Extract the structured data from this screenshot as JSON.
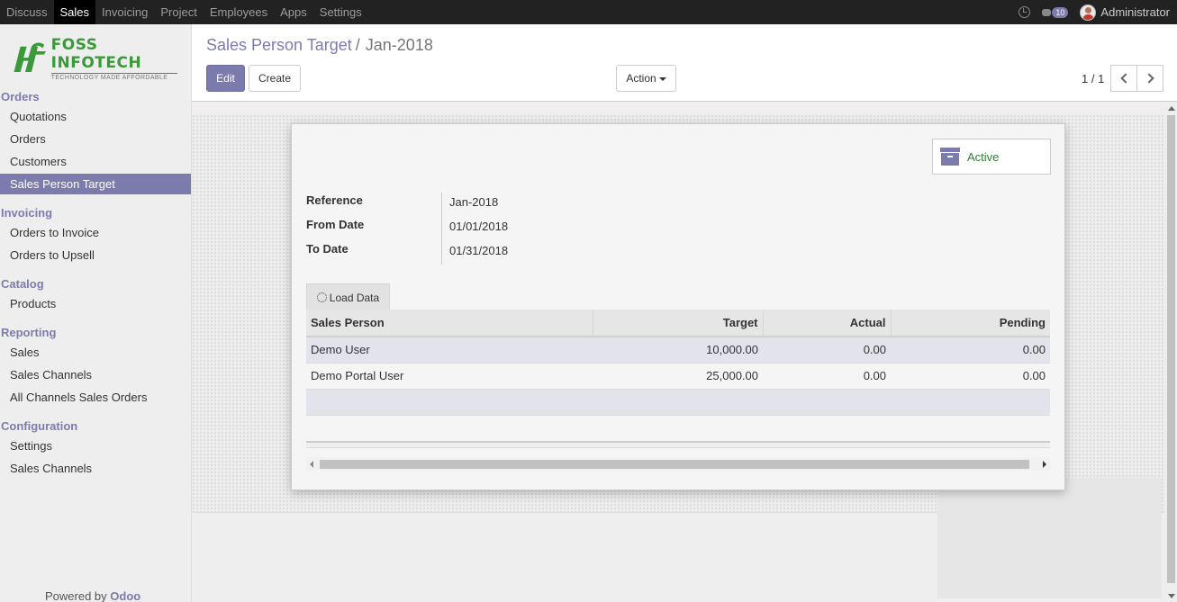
{
  "topnav": {
    "items": [
      "Discuss",
      "Sales",
      "Invoicing",
      "Project",
      "Employees",
      "Apps",
      "Settings"
    ],
    "active": "Sales",
    "messages_count": "10",
    "user_name": "Administrator"
  },
  "logo": {
    "title": "FOSS INFOTECH",
    "tagline": "TECHNOLOGY MADE AFFORDABLE"
  },
  "sidebar": {
    "sections": [
      {
        "header": "Orders",
        "items": [
          "Quotations",
          "Orders",
          "Customers",
          "Sales Person Target"
        ]
      },
      {
        "header": "Invoicing",
        "items": [
          "Orders to Invoice",
          "Orders to Upsell"
        ]
      },
      {
        "header": "Catalog",
        "items": [
          "Products"
        ]
      },
      {
        "header": "Reporting",
        "items": [
          "Sales",
          "Sales Channels",
          "All Channels Sales Orders"
        ]
      },
      {
        "header": "Configuration",
        "items": [
          "Settings",
          "Sales Channels"
        ]
      }
    ],
    "active_item": "Sales Person Target",
    "powered_prefix": "Powered by",
    "powered_brand": "Odoo"
  },
  "control": {
    "breadcrumb_parent": "Sales Person Target",
    "breadcrumb_separator": "/",
    "breadcrumb_current": "Jan-2018",
    "edit_label": "Edit",
    "create_label": "Create",
    "action_label": "Action",
    "pager_value": "1 / 1"
  },
  "form": {
    "status_label": "Active",
    "fields": [
      {
        "label": "Reference",
        "value": "Jan-2018"
      },
      {
        "label": "From Date",
        "value": "01/01/2018"
      },
      {
        "label": "To Date",
        "value": "01/31/2018"
      }
    ],
    "load_button_label": "Load Data",
    "table": {
      "headers": [
        "Sales Person",
        "Target",
        "Actual",
        "Pending"
      ],
      "rows": [
        [
          "Demo User",
          "10,000.00",
          "0.00",
          "0.00"
        ],
        [
          "Demo Portal User",
          "25,000.00",
          "0.00",
          "0.00"
        ]
      ]
    }
  },
  "colors": {
    "accent": "#7c7bad",
    "navbar": "#222222",
    "status_green": "#2e7d32",
    "logo_green": "#3a9a3a"
  }
}
